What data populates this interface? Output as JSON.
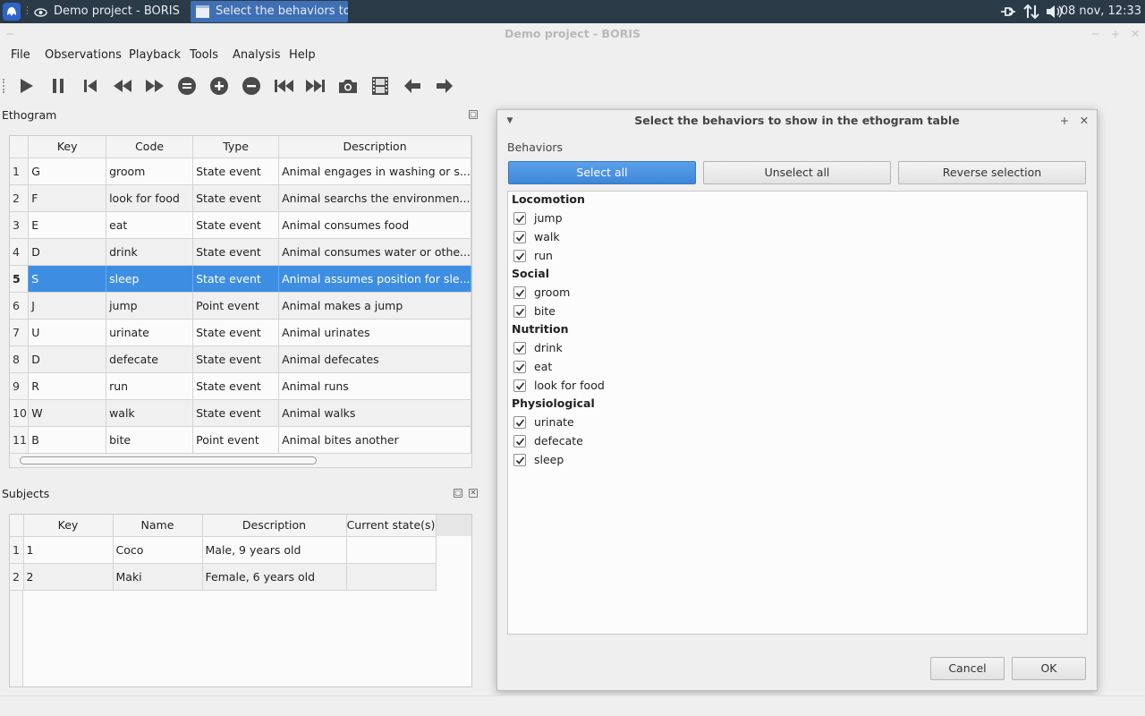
{
  "taskbar": {
    "tasks": [
      {
        "label": "Demo project - BORIS"
      },
      {
        "label": "Select the behaviors to s..."
      }
    ],
    "clock": "08 nov, 12:33"
  },
  "window": {
    "title": "Demo project - BORIS"
  },
  "menu": [
    "File",
    "Observations",
    "Playback",
    "Tools",
    "Analysis",
    "Help"
  ],
  "toolbar": {
    "icons": [
      "play-icon",
      "pause-icon",
      "skip-previous-icon",
      "rewind-icon",
      "fast-forward-icon",
      "equal-icon",
      "plus-icon",
      "minus-icon",
      "jump-backward-icon",
      "jump-forward-icon",
      "camera-icon",
      "film-icon",
      "arrow-left-icon",
      "arrow-right-icon"
    ]
  },
  "ethogram": {
    "title": "Ethogram",
    "columns": [
      "Key",
      "Code",
      "Type",
      "Description"
    ],
    "rows": [
      {
        "n": "1",
        "key": "G",
        "code": "groom",
        "type": "State event",
        "desc": "Animal engages in washing or s..."
      },
      {
        "n": "2",
        "key": "F",
        "code": "look for food",
        "type": "State event",
        "desc": "Animal searchs the environmen..."
      },
      {
        "n": "3",
        "key": "E",
        "code": "eat",
        "type": "State event",
        "desc": "Animal consumes food"
      },
      {
        "n": "4",
        "key": "D",
        "code": "drink",
        "type": "State event",
        "desc": "Animal consumes water or othe..."
      },
      {
        "n": "5",
        "key": "S",
        "code": "sleep",
        "type": "State event",
        "desc": "Animal assumes position for sle..."
      },
      {
        "n": "6",
        "key": "J",
        "code": "jump",
        "type": "Point event",
        "desc": "Animal makes a jump"
      },
      {
        "n": "7",
        "key": "U",
        "code": "urinate",
        "type": "State event",
        "desc": "Animal urinates"
      },
      {
        "n": "8",
        "key": "D",
        "code": "defecate",
        "type": "State event",
        "desc": "Animal defecates"
      },
      {
        "n": "9",
        "key": "R",
        "code": "run",
        "type": "State event",
        "desc": "Animal runs"
      },
      {
        "n": "10",
        "key": "W",
        "code": "walk",
        "type": "State event",
        "desc": "Animal walks"
      },
      {
        "n": "11",
        "key": "B",
        "code": "bite",
        "type": "Point event",
        "desc": "Animal bites another"
      }
    ],
    "selected_row": 5
  },
  "subjects": {
    "title": "Subjects",
    "columns": [
      "Key",
      "Name",
      "Description",
      "Current state(s)"
    ],
    "rows": [
      {
        "n": "1",
        "key": "1",
        "name": "Coco",
        "desc": "Male, 9 years old",
        "state": ""
      },
      {
        "n": "2",
        "key": "2",
        "name": "Maki",
        "desc": "Female, 6 years old",
        "state": ""
      }
    ]
  },
  "dialog": {
    "title": "Select the behaviors to show in the ethogram table",
    "label": "Behaviors",
    "select_all": "Select all",
    "unselect_all": "Unselect all",
    "reverse": "Reverse selection",
    "groups": [
      {
        "name": "Locomotion",
        "items": [
          {
            "label": "jump",
            "checked": true
          },
          {
            "label": "walk",
            "checked": true
          },
          {
            "label": "run",
            "checked": true
          }
        ]
      },
      {
        "name": "Social",
        "items": [
          {
            "label": "groom",
            "checked": true
          },
          {
            "label": "bite",
            "checked": true
          }
        ]
      },
      {
        "name": "Nutrition",
        "items": [
          {
            "label": "drink",
            "checked": true
          },
          {
            "label": "eat",
            "checked": true
          },
          {
            "label": "look for food",
            "checked": true
          }
        ]
      },
      {
        "name": "Physiological",
        "items": [
          {
            "label": "urinate",
            "checked": true
          },
          {
            "label": "defecate",
            "checked": true
          },
          {
            "label": "sleep",
            "checked": true
          }
        ]
      }
    ],
    "cancel": "Cancel",
    "ok": "OK"
  },
  "colors": {
    "accent": "#3d8ee2",
    "taskbar": "#2b3a47"
  }
}
